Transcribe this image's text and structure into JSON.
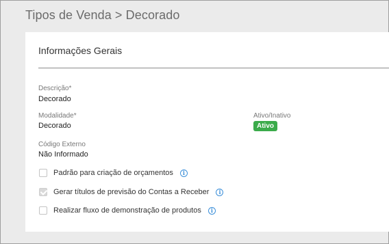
{
  "breadcrumb": {
    "text": "Tipos de Venda > Decorado"
  },
  "section": {
    "title": "Informações Gerais"
  },
  "fields": {
    "descricao": {
      "label": "Descrição*",
      "value": "Decorado"
    },
    "modalidade": {
      "label": "Modalidade*",
      "value": "Decorado"
    },
    "ativo": {
      "label": "Ativo/Inativo",
      "value": "Ativo",
      "color": "#3bab4b"
    },
    "codigo_externo": {
      "label": "Código Externo",
      "value": "Não Informado"
    }
  },
  "options": [
    {
      "label": "Padrão para criação de orçamentos",
      "checked": false,
      "icon": "info-icon"
    },
    {
      "label": "Gerar títulos de previsão do Contas a Receber",
      "checked": true,
      "icon": "info-icon"
    },
    {
      "label": "Realizar fluxo de demonstração de produtos",
      "checked": false,
      "icon": "info-icon"
    }
  ],
  "colors": {
    "accent": "#3b8fd9",
    "background": "#ebebeb",
    "card": "#ffffff"
  }
}
